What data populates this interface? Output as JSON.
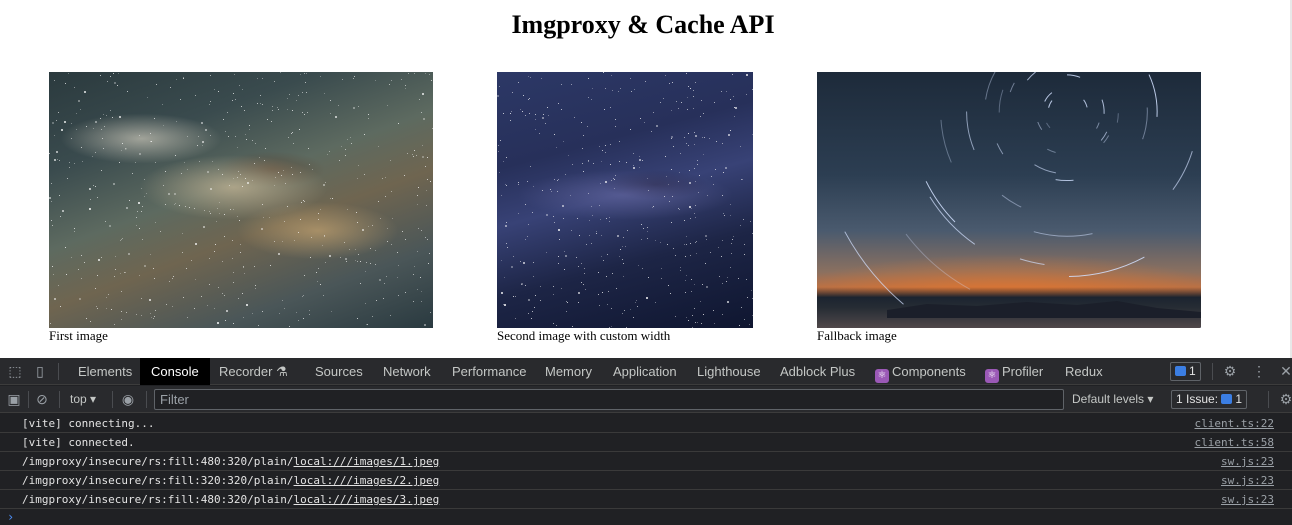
{
  "page": {
    "title": "Imgproxy & Cache API",
    "images": [
      {
        "caption": "First image",
        "alt": "Milky way galaxy"
      },
      {
        "caption": "Second image with custom width",
        "alt": "Starry night sky"
      },
      {
        "caption": "Fallback image",
        "alt": "Star trails over sunset"
      }
    ]
  },
  "devtools": {
    "tabs": [
      "Elements",
      "Console",
      "Recorder",
      "Sources",
      "Network",
      "Performance",
      "Memory",
      "Application",
      "Lighthouse",
      "Adblock Plus",
      "Components",
      "Profiler",
      "Redux"
    ],
    "active_tab": "Console",
    "messages_badge": "1",
    "toolbar": {
      "context": "top",
      "filter_placeholder": "Filter",
      "levels": "Default levels",
      "issues_label": "1 Issue:",
      "issues_count": "1"
    },
    "logs": [
      {
        "prefix": "[vite] connecting...",
        "link": "",
        "source": "client.ts:22"
      },
      {
        "prefix": "[vite] connected.",
        "link": "",
        "source": "client.ts:58"
      },
      {
        "prefix": "/imgproxy/insecure/rs:fill:480:320/plain/",
        "link": "local:///images/1.jpeg",
        "source": "sw.js:23"
      },
      {
        "prefix": "/imgproxy/insecure/rs:fill:320:320/plain/",
        "link": "local:///images/2.jpeg",
        "source": "sw.js:23"
      },
      {
        "prefix": "/imgproxy/insecure/rs:fill:480:320/plain/",
        "link": "local:///images/3.jpeg",
        "source": "sw.js:23"
      }
    ],
    "prompt": "›"
  },
  "colors": {
    "devtools_bg": "#202124",
    "tabbar_bg": "#292a2d",
    "active_tab_bg": "#000000",
    "accent": "#3b7ee3",
    "react_badge": "#9b59b6"
  }
}
